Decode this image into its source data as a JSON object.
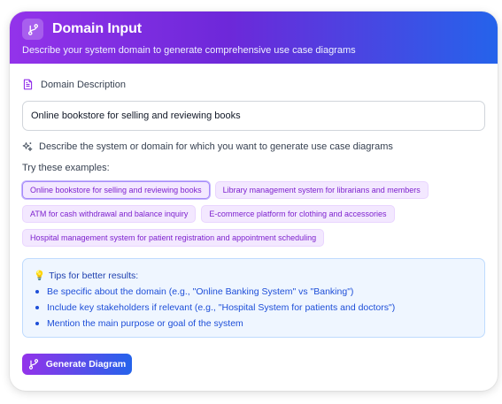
{
  "header": {
    "title": "Domain Input",
    "subtitle": "Describe your system domain to generate comprehensive use case diagrams",
    "icon": "branch-icon"
  },
  "domain": {
    "label": "Domain Description",
    "value": "Online bookstore for selling and reviewing books",
    "hint": "Describe the system or domain for which you want to generate use case diagrams"
  },
  "examples": {
    "label": "Try these examples:",
    "items": [
      "Online bookstore for selling and reviewing books",
      "Library management system for librarians and members",
      "ATM for cash withdrawal and balance inquiry",
      "E-commerce platform for clothing and accessories",
      "Hospital management system for patient registration and appointment scheduling"
    ],
    "selected_index": 0
  },
  "tips": {
    "title": "Tips for better results:",
    "items": [
      "Be specific about the domain (e.g., \"Online Banking System\" vs \"Banking\")",
      "Include key stakeholders if relevant (e.g., \"Hospital System for patients and doctors\")",
      "Mention the main purpose or goal of the system"
    ]
  },
  "actions": {
    "generate_label": "Generate Diagram"
  },
  "colors": {
    "gradient_start": "#9333ea",
    "gradient_end": "#2563eb",
    "chip_bg": "#f3e8ff",
    "chip_text": "#7e22ce",
    "tips_bg": "#eff6ff",
    "tips_text": "#1d4ed8"
  }
}
